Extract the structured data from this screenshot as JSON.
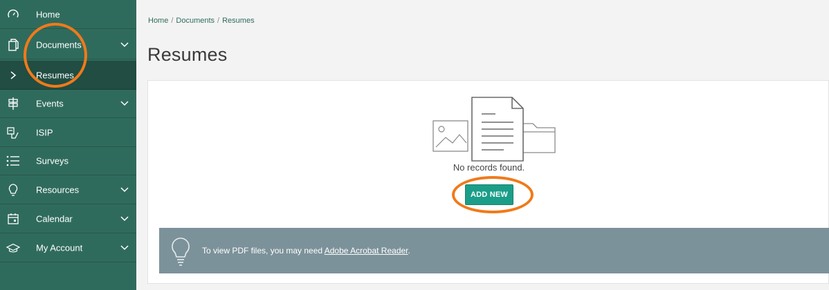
{
  "sidebar": {
    "items": [
      {
        "label": "Home",
        "icon": "speedometer-icon"
      },
      {
        "label": "Documents",
        "icon": "documents-icon"
      },
      {
        "label": "Resumes",
        "icon": "chevron-right-icon"
      },
      {
        "label": "Events",
        "icon": "signpost-icon"
      },
      {
        "label": "ISIP",
        "icon": "isip-icon"
      },
      {
        "label": "Surveys",
        "icon": "list-icon"
      },
      {
        "label": "Resources",
        "icon": "lightbulb-icon"
      },
      {
        "label": "Calendar",
        "icon": "calendar-icon"
      },
      {
        "label": "My Account",
        "icon": "graduation-cap-icon"
      }
    ]
  },
  "breadcrumb": {
    "items": [
      "Home",
      "Documents",
      "Resumes"
    ],
    "separator": "/"
  },
  "main": {
    "title": "Resumes",
    "empty_text": "No records found.",
    "add_button": "ADD NEW",
    "info_prefix": "To view PDF files, you may need ",
    "info_link": "Adobe Acrobat Reader",
    "info_suffix": "."
  },
  "colors": {
    "sidebar": "#2f6b5c",
    "sidebar_active": "#214d42",
    "accent_button": "#1b9e89",
    "info_bar": "#7c929a",
    "annotation": "#f07a1a"
  }
}
